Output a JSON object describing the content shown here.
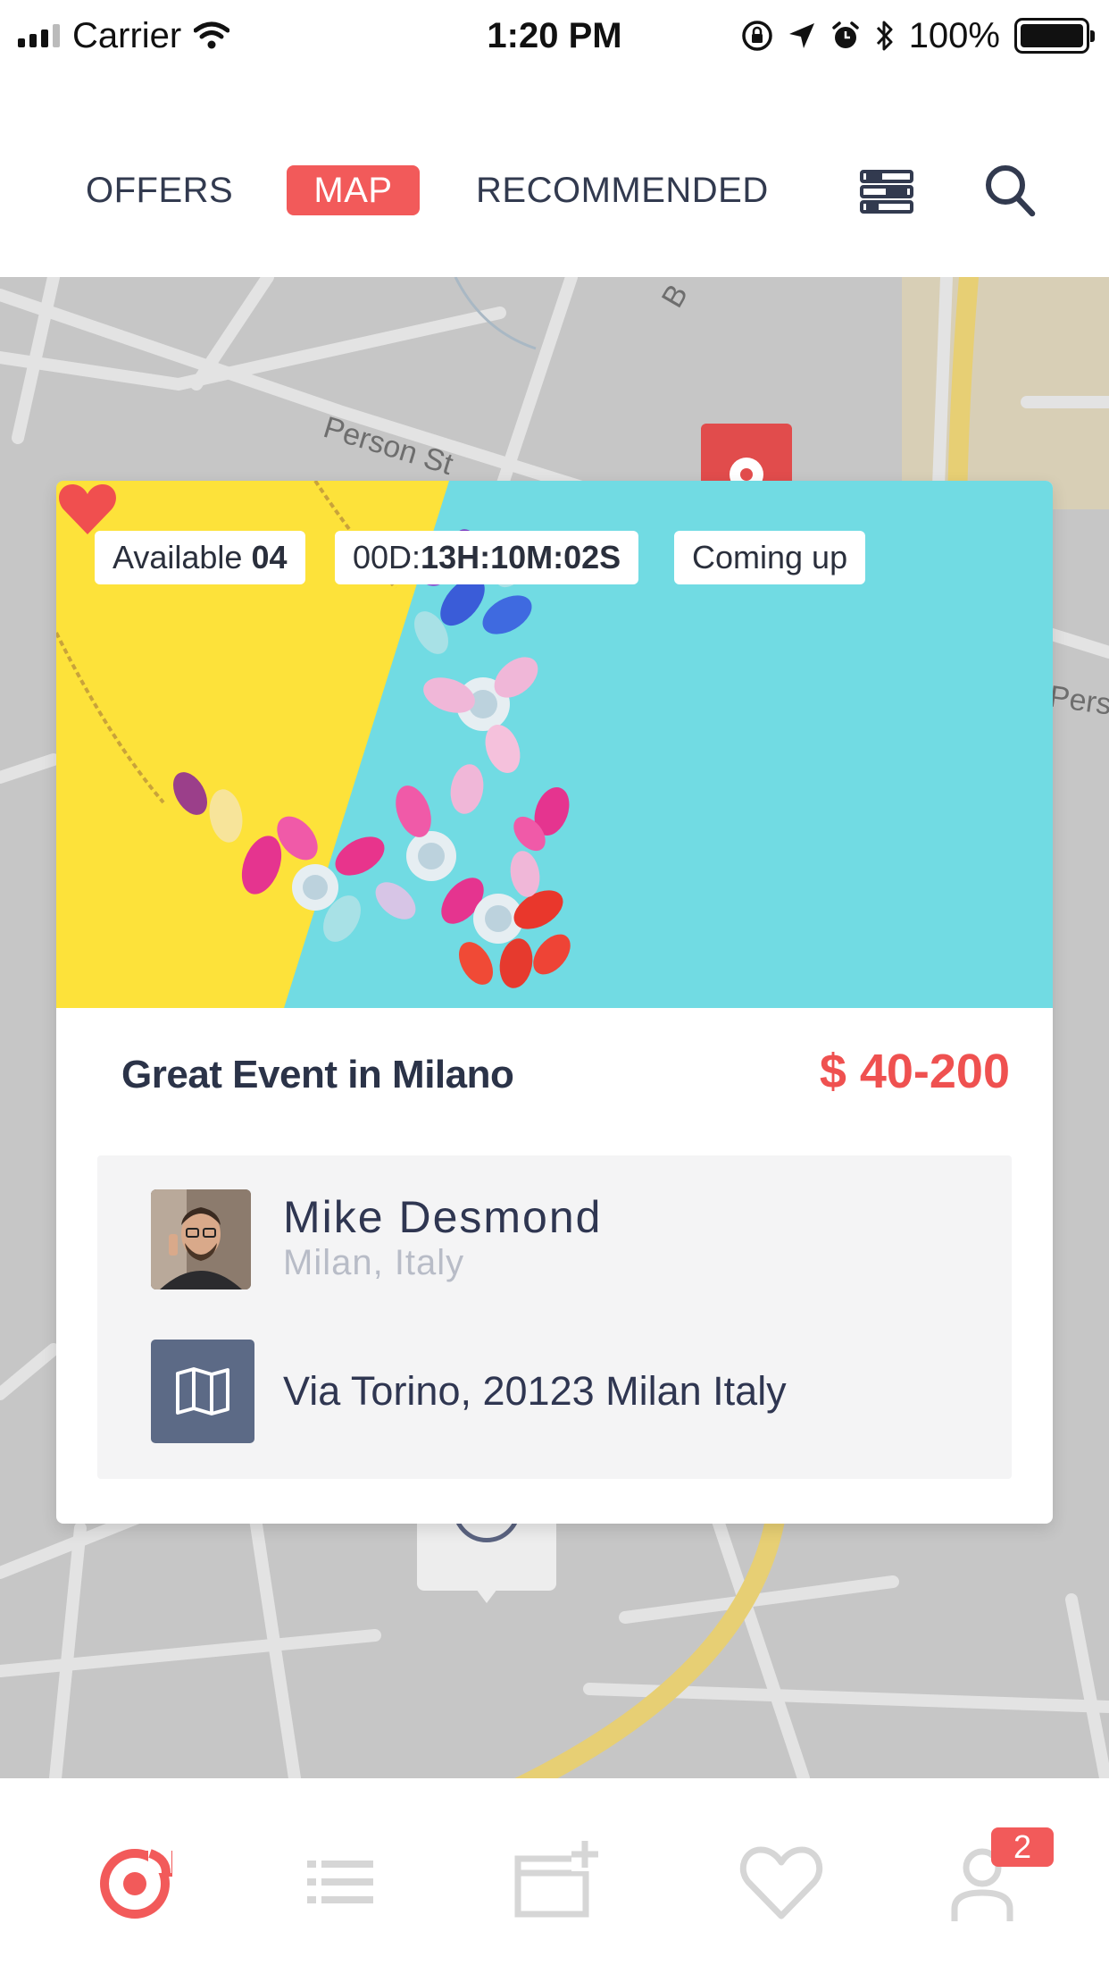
{
  "status_bar": {
    "carrier": "Carrier",
    "time": "1:20 PM",
    "battery_percent": "100%",
    "battery_level": 1.0,
    "icons": [
      "signal-icon",
      "wifi-icon",
      "rotation-lock-icon",
      "location-arrow-icon",
      "alarm-icon",
      "bluetooth-icon",
      "battery-icon"
    ]
  },
  "header": {
    "tabs": [
      {
        "label": "OFFERS",
        "active": false
      },
      {
        "label": "MAP",
        "active": true
      },
      {
        "label": "RECOMMENDED",
        "active": false
      }
    ],
    "icons": [
      "filter-icon",
      "search-icon"
    ]
  },
  "map": {
    "street_labels": [
      "Person St",
      "Pers",
      "B"
    ]
  },
  "event_card": {
    "available_label": "Available",
    "available_count": "04",
    "timer_prefix": "00D:",
    "timer_value": "13H:10M:02S",
    "status": "Coming up",
    "favorited": true,
    "title": "Great Event in Milano",
    "price": "$ 40-200",
    "host": {
      "name": "Mike Desmond",
      "location": "Milan, Italy"
    },
    "address": "Via Torino, 20123 Milan Italy"
  },
  "bottom_nav": {
    "items": [
      "explore-icon",
      "list-icon",
      "add-event-icon",
      "favorites-icon",
      "profile-icon"
    ],
    "active": "explore-icon",
    "profile_badge": "2"
  },
  "colors": {
    "accent": "#f25a5a",
    "text_dark": "#2f3651",
    "map_bg": "#c6c6c6",
    "icon_box": "#5c6a86"
  }
}
